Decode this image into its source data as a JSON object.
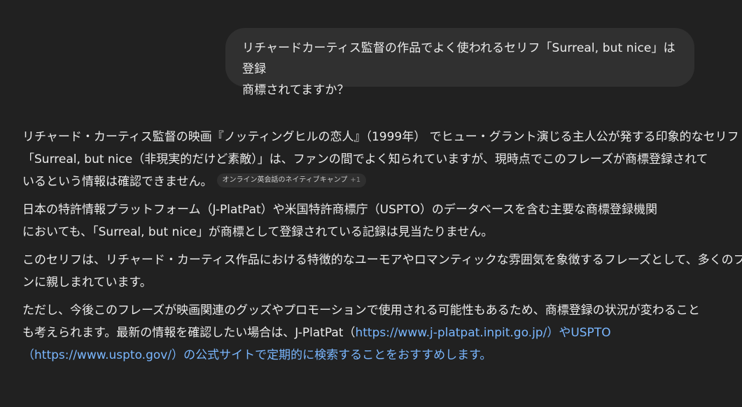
{
  "user_message": {
    "line1": "リチャードカーティス監督の作品でよく使われるセリフ「Surreal, but nice」は登録",
    "line2": "商標されてますか？"
  },
  "assistant": {
    "p1": {
      "line1": "リチャード・カーティス監督の映画『ノッティングヒルの恋人』（1999年） でヒュー・グラント演じる主人公が発する印象的なセリフ",
      "line2": "「Surreal, but nice（非現実的だけど素敵）」は、ファンの間でよく知られていますが、現時点でこのフレーズが商標登録されて",
      "line3": "いるという情報は確認できません。",
      "citation_label": "オンライン英会話のネイティブキャンプ",
      "citation_count": "+1"
    },
    "p2": {
      "line1": "日本の特許情報プラットフォーム（J-PlatPat）や米国特許商標庁（USPTO）のデータベースを含む主要な商標登録機関",
      "line2": "においても、「Surreal, but nice」が商標として登録されている記録は見当たりません。"
    },
    "p3": {
      "line1": "このセリフは、リチャード・カーティス作品における特徴的なユーモアやロマンティックな雰囲気を象徴するフレーズとして、多くのファ",
      "line2": "ンに親しまれています。"
    },
    "p4": {
      "line1": "ただし、今後このフレーズが映画関連のグッズやプロモーションで使用される可能性もあるため、商標登録の状況が変わるこ",
      "line1b": "と",
      "line2_a": "も考えられます。最新の情報を確認したい場合は、J-PlatPat（",
      "link1": "https://www.j-platpat.inpit.go.jp/",
      "line2_b": "）や",
      "link2_text": "USPTO",
      "line3_a": "（",
      "link3": "https://www.uspto.gov/",
      "line3_b": "）の公式サイトで定期的に検索することをおすすめします。"
    }
  },
  "colors": {
    "background": "#212121",
    "bubble": "#303030",
    "text": "#ececec",
    "link": "#7ab7ff"
  }
}
